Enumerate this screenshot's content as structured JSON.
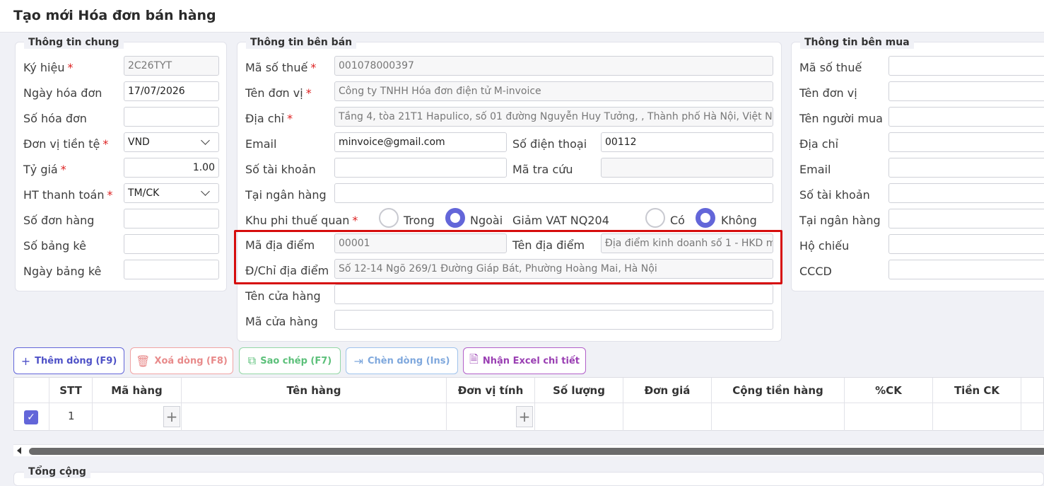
{
  "window": {
    "title": "Tạo mới Hóa đơn bán hàng"
  },
  "general": {
    "title": "Thông tin chung",
    "ky_hieu": {
      "label": "Ký hiệu",
      "value": "2C26TYT"
    },
    "ngay_hoa_don": {
      "label": "Ngày hóa đơn",
      "value": "17/07/2026"
    },
    "so_hoa_don": {
      "label": "Số hóa đơn",
      "value": ""
    },
    "don_vi_tien_te": {
      "label": "Đơn vị tiền tệ",
      "value": "VND"
    },
    "ty_gia": {
      "label": "Tỷ giá",
      "value": "1.00"
    },
    "ht_thanh_toan": {
      "label": "HT thanh toán",
      "value": "TM/CK"
    },
    "so_don_hang": {
      "label": "Số đơn hàng",
      "value": ""
    },
    "so_bang_ke": {
      "label": "Số bảng kê",
      "value": ""
    },
    "ngay_bang_ke": {
      "label": "Ngày bảng kê",
      "value": ""
    }
  },
  "seller": {
    "title": "Thông tin bên bán",
    "ma_so_thue": {
      "label": "Mã số thuế",
      "value": "001078000397"
    },
    "ten_don_vi": {
      "label": "Tên đơn vị",
      "value": "Công ty TNHH Hóa đơn điện tử M-invoice"
    },
    "dia_chi": {
      "label": "Địa chỉ",
      "value": "Tầng 4, tòa 21T1 Hapulico, số 01 đường Nguyễn Huy Tưởng, , Thành phố Hà Nội, Việt N"
    },
    "email": {
      "label": "Email",
      "value": "minvoice@gmail.com"
    },
    "so_dien_thoai": {
      "label": "Số điện thoại",
      "value": "00112"
    },
    "so_tai_khoan": {
      "label": "Số tài khoản",
      "value": ""
    },
    "ma_tra_cuu": {
      "label": "Mã tra cứu",
      "value": ""
    },
    "tai_ngan_hang": {
      "label": "Tại ngân hàng",
      "value": ""
    },
    "khu_phi_thue_quan": {
      "label": "Khu phi thuế quan",
      "opt1": "Trong",
      "opt2": "Ngoài",
      "selected": "Ngoài"
    },
    "giam_vat": {
      "label": "Giảm VAT NQ204",
      "opt1": "Có",
      "opt2": "Không",
      "selected": "Không"
    },
    "ma_dia_diem": {
      "label": "Mã địa điểm",
      "value": "00001"
    },
    "ten_dia_diem": {
      "label": "Tên địa điểm",
      "value": "Địa điểm kinh doanh số 1 - HKD m"
    },
    "dchi_dia_diem": {
      "label": "Đ/Chỉ địa điểm",
      "value": "Số 12-14 Ngõ 269/1 Đường Giáp Bát, Phường Hoàng Mai, Hà Nội"
    },
    "ten_cua_hang": {
      "label": "Tên cửa hàng",
      "value": ""
    },
    "ma_cua_hang": {
      "label": "Mã cửa hàng",
      "value": ""
    }
  },
  "buyer": {
    "title": "Thông tin bên mua",
    "ma_so_thue": {
      "label": "Mã số thuế"
    },
    "ten_don_vi": {
      "label": "Tên đơn vị"
    },
    "ten_nguoi_mua": {
      "label": "Tên người mua"
    },
    "dia_chi": {
      "label": "Địa chỉ"
    },
    "email": {
      "label": "Email"
    },
    "so_tai_khoan": {
      "label": "Số tài khoản"
    },
    "tai_ngan_hang": {
      "label": "Tại ngân hàng"
    },
    "ho_chieu": {
      "label": "Hộ chiếu"
    },
    "cccd": {
      "label": "CCCD"
    }
  },
  "toolbar": {
    "them_dong": "Thêm dòng (F9)",
    "xoa_dong": "Xoá dòng (F8)",
    "sao_chep": "Sao chép (F7)",
    "chen_dong": "Chèn dòng (Ins)",
    "nhan_excel": "Nhận Excel chi tiết"
  },
  "grid": {
    "columns": [
      "STT",
      "Mã hàng",
      "Tên hàng",
      "Đơn vị tính",
      "Số lượng",
      "Đơn giá",
      "Cộng tiền hàng",
      "%CK",
      "Tiền CK"
    ],
    "rows": [
      {
        "stt": "1",
        "checked": true
      }
    ]
  },
  "footer": {
    "title": "Tổng cộng"
  },
  "colors": {
    "accent": "#6366d9",
    "highlight": "#d60d0d"
  }
}
